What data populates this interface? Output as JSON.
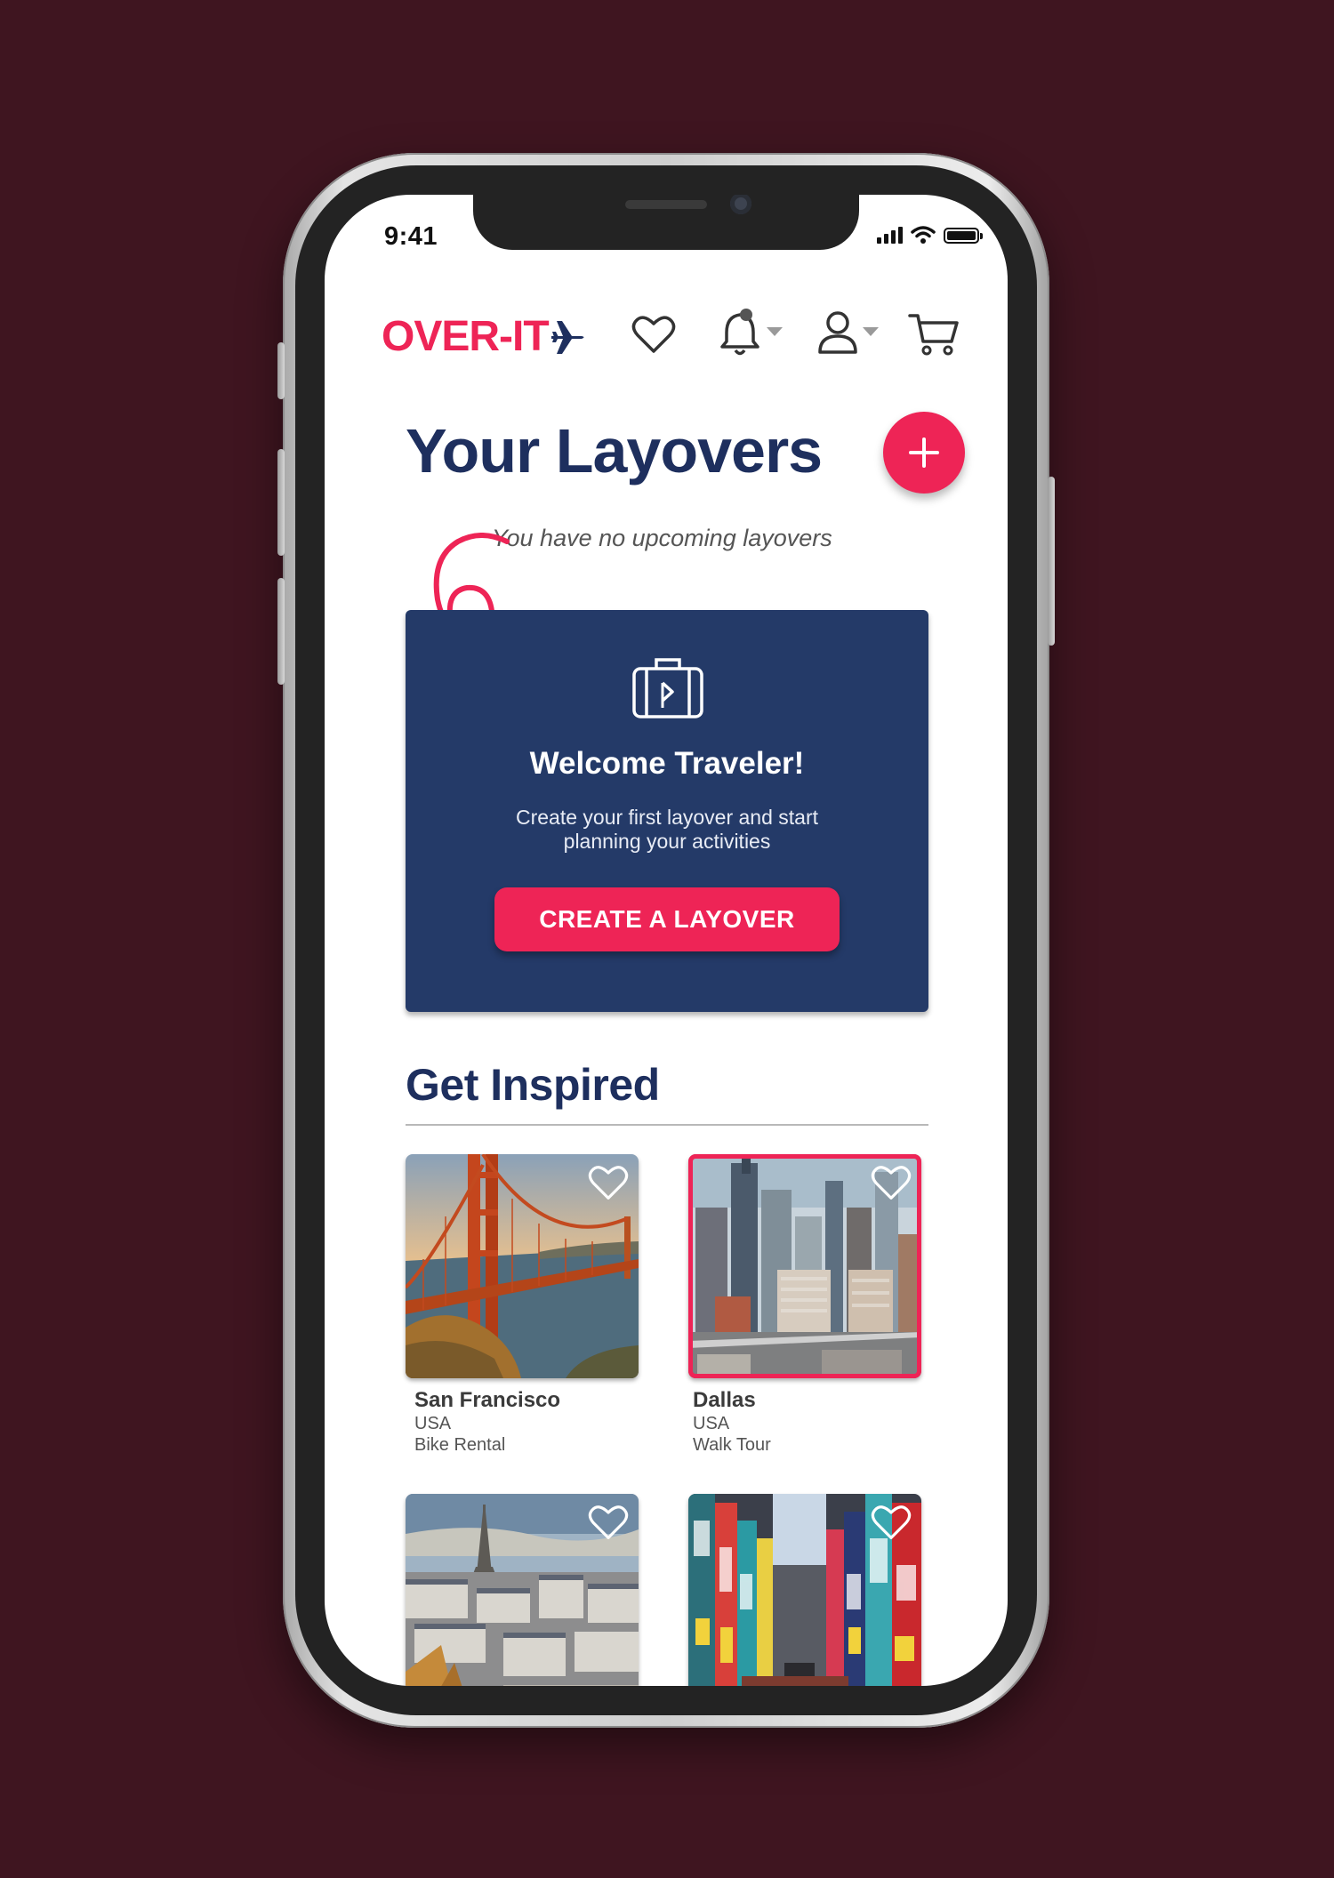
{
  "status_bar": {
    "time": "9:41"
  },
  "header": {
    "logo_text": "OVER-IT",
    "icons": [
      "heart-icon",
      "bell-icon",
      "user-icon",
      "cart-icon"
    ]
  },
  "layovers": {
    "title": "Your Layovers",
    "empty_note": "You have no upcoming layovers",
    "welcome": {
      "title": "Welcome Traveler!",
      "text": "Create your first layover and start planning your activities",
      "button": "CREATE A LAYOVER"
    }
  },
  "inspired": {
    "title": "Get Inspired",
    "cards": [
      {
        "city": "San Francisco",
        "country": "USA",
        "activity": "Bike Rental",
        "selected": false
      },
      {
        "city": "Dallas",
        "country": "USA",
        "activity": "Walk Tour",
        "selected": true
      },
      {
        "city": "",
        "country": "",
        "activity": "",
        "selected": false
      },
      {
        "city": "",
        "country": "",
        "activity": "",
        "selected": false
      }
    ]
  },
  "colors": {
    "brand_pink": "#ee2456",
    "navy": "#1e2f5e",
    "card_navy": "#243a68",
    "background": "#3f1520"
  }
}
